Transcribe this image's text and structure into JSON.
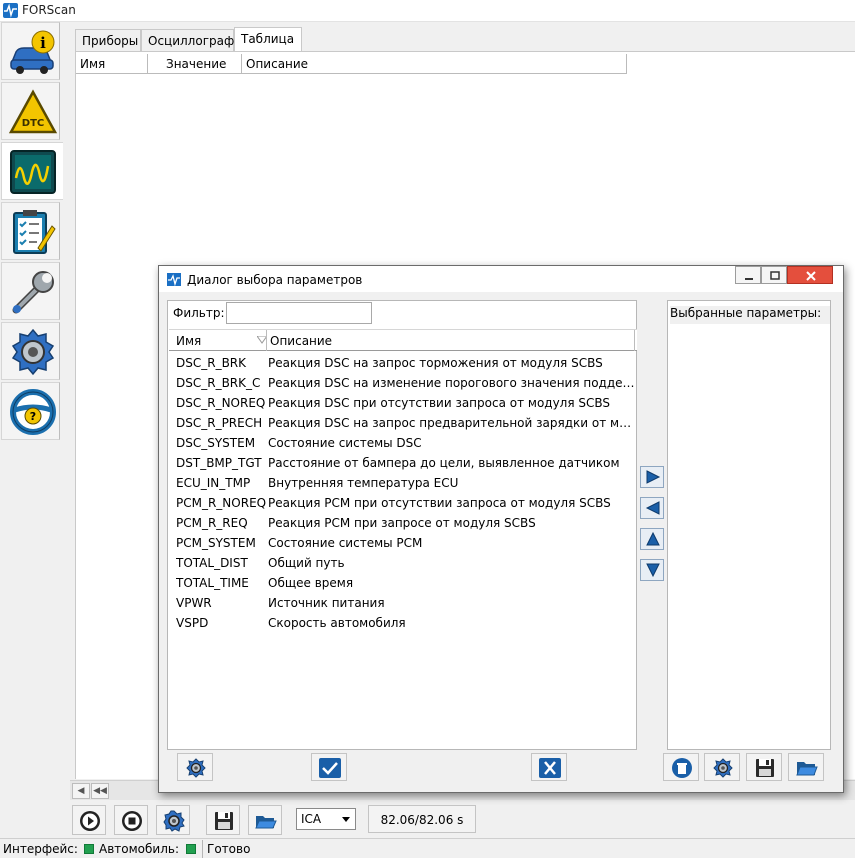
{
  "window": {
    "title": "FORScan"
  },
  "left_nav": [
    {
      "id": "vehicle-info",
      "icon": "car-info-icon"
    },
    {
      "id": "dtc",
      "icon": "dtc-warning-icon"
    },
    {
      "id": "oscilloscope",
      "icon": "oscilloscope-icon"
    },
    {
      "id": "tests",
      "icon": "checklist-icon"
    },
    {
      "id": "service",
      "icon": "wrench-icon"
    },
    {
      "id": "configuration",
      "icon": "gear-icon"
    },
    {
      "id": "help",
      "icon": "steering-help-icon"
    }
  ],
  "tabs": [
    "Приборы",
    "Осциллограф",
    "Таблица"
  ],
  "table": {
    "columns": [
      "Имя",
      "Значение",
      "Описание"
    ]
  },
  "dialog": {
    "title": "Диалог выбора параметров",
    "filter_label": "Фильтр:",
    "filter_value": "",
    "list_columns": [
      "Имя",
      "Описание"
    ],
    "selected_label": "Выбранные параметры:",
    "rows": [
      {
        "name": "DSC_R_BRK",
        "desc": "Реакция DSC на запрос торможения от модуля SCBS"
      },
      {
        "name": "DSC_R_BRK_C",
        "desc": "Реакция DSC на изменение порогового значения поддерж..."
      },
      {
        "name": "DSC_R_NOREQ",
        "desc": "Реакция DSC при отсутствии запроса от модуля SCBS"
      },
      {
        "name": "DSC_R_PRECH",
        "desc": "Реакция DSC на запрос предварительной зарядки от моду..."
      },
      {
        "name": "DSC_SYSTEM",
        "desc": "Состояние системы DSC"
      },
      {
        "name": "DST_BMP_TGT",
        "desc": "Расстояние от бампера до цели, выявленное датчиком"
      },
      {
        "name": "ECU_IN_TMP",
        "desc": "Внутренняя температура ECU"
      },
      {
        "name": "PCM_R_NOREQ",
        "desc": "Реакция PCM при отсутствии запроса от модуля SCBS"
      },
      {
        "name": "PCM_R_REQ",
        "desc": "Реакция PCM при запросе от модуля SCBS"
      },
      {
        "name": "PCM_SYSTEM",
        "desc": "Состояние системы PCM"
      },
      {
        "name": "TOTAL_DIST",
        "desc": "Общий путь"
      },
      {
        "name": "TOTAL_TIME",
        "desc": "Общее время"
      },
      {
        "name": "VPWR",
        "desc": "Источник питания"
      },
      {
        "name": "VSPD",
        "desc": "Скорость автомобиля"
      }
    ]
  },
  "toolbar": {
    "combo_value": "ICA",
    "time_readout": "82.06/82.06 s"
  },
  "status": {
    "interface_label": "Интерфейс:",
    "vehicle_label": "Автомобиль:",
    "state_text": "Готово"
  },
  "colors": {
    "accent": "#1a5fa8",
    "status_led": "#22a050",
    "close_button": "#e44f3d"
  }
}
